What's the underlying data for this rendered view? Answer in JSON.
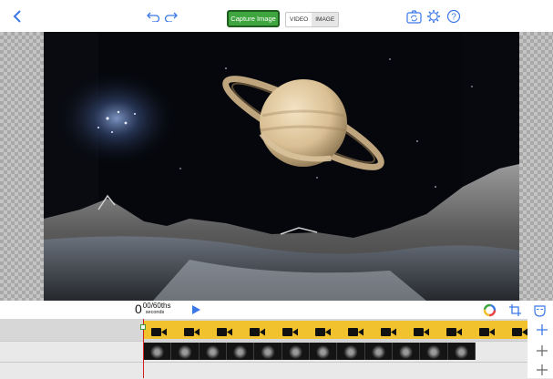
{
  "toolbar": {
    "back_icon": "chevron-left-icon",
    "undo_icon": "undo-icon",
    "redo_icon": "redo-icon",
    "capture_label": "Capture Image",
    "video_label": "VIDEO",
    "image_label": "IMAGE",
    "mode_selected": "IMAGE",
    "camera_icon": "camera-rotate-icon",
    "settings_icon": "gear-icon",
    "help_label": "?"
  },
  "playback": {
    "time_seconds": "0",
    "time_fraction": "00/60ths",
    "time_unit": "seconds",
    "play_icon": "play-icon",
    "color_icon": "color-wheel-icon",
    "crop_icon": "crop-icon",
    "mask_icon": "mask-icon"
  },
  "timeline": {
    "video_clip_icon": "video-camera-icon",
    "video_clip_icon_count": 12,
    "thumbnail_count": 12,
    "add_labels": [
      "+",
      "+",
      "+"
    ]
  },
  "colors": {
    "accent_green": "#3fa63f",
    "toolbar_blue": "#3b78e7",
    "clip_yellow": "#f2c12e",
    "playhead_red": "#d02020"
  }
}
